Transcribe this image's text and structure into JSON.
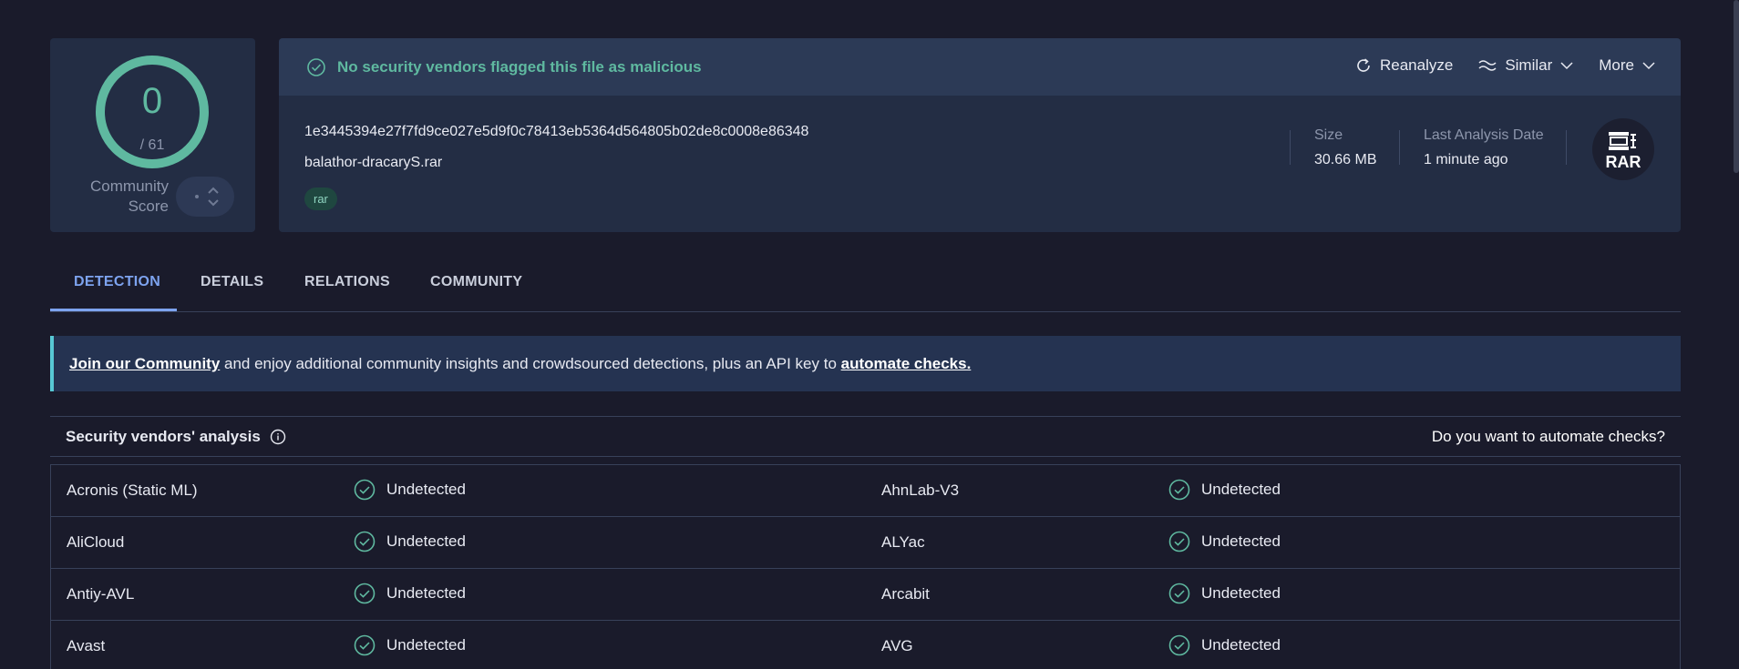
{
  "score": {
    "value": "0",
    "total": "/ 61",
    "community_label_line1": "Community",
    "community_label_line2": "Score",
    "fraction": 0
  },
  "header": {
    "verdict": "No security vendors flagged this file as malicious",
    "actions": {
      "reanalyze": "Reanalyze",
      "similar": "Similar",
      "more": "More"
    }
  },
  "file": {
    "hash": "1e3445394e27f7fd9ce027e5d9f0c78413eb5364d564805b02de8c0008e86348",
    "name": "balathor-dracaryS.rar",
    "tag": "rar",
    "size_label": "Size",
    "size_value": "30.66 MB",
    "date_label": "Last Analysis Date",
    "date_value": "1 minute ago",
    "type_icon": "RAR"
  },
  "tabs": [
    "DETECTION",
    "DETAILS",
    "RELATIONS",
    "COMMUNITY"
  ],
  "banner": {
    "link1": "Join our Community",
    "middle": " and enjoy additional community insights and crowdsourced detections, plus an API key to ",
    "link2": "automate checks."
  },
  "vendors": {
    "title": "Security vendors' analysis",
    "automate": "Do you want to automate checks?",
    "rows": [
      {
        "left": "Acronis (Static ML)",
        "left_result": "Undetected",
        "right": "AhnLab-V3",
        "right_result": "Undetected"
      },
      {
        "left": "AliCloud",
        "left_result": "Undetected",
        "right": "ALYac",
        "right_result": "Undetected"
      },
      {
        "left": "Antiy-AVL",
        "left_result": "Undetected",
        "right": "Arcabit",
        "right_result": "Undetected"
      },
      {
        "left": "Avast",
        "left_result": "Undetected",
        "right": "AVG",
        "right_result": "Undetected"
      }
    ]
  },
  "colors": {
    "accent_green": "#5fb9a0",
    "accent_blue": "#7da3ef",
    "background": "#1a1b2b",
    "card": "#232d44"
  }
}
